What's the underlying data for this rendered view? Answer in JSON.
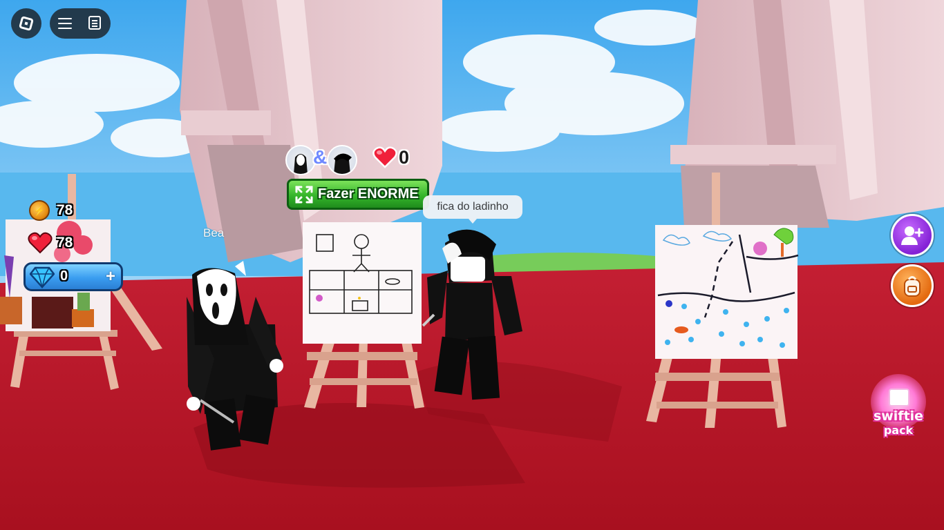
{
  "hud": {
    "roblox_menu_icon": "roblox-logo-icon",
    "menu_icon": "hamburger-menu-icon",
    "chat_icon": "chat-icon",
    "coins": "78",
    "hearts": "78",
    "gems": "0",
    "gems_add_label": "+"
  },
  "canvas_overlay": {
    "painters_joiner": "&",
    "likes": "0",
    "enorme_button_label": "Fazer ENORME"
  },
  "chat": {
    "bubble_text": "fica do ladinho"
  },
  "players": {
    "nearby_name": "Bea"
  },
  "side_buttons": {
    "invite_icon": "add-friend-icon",
    "backpack_icon": "backpack-icon",
    "swiftie_line1": "swiftie",
    "swiftie_line2": "pack"
  },
  "colors": {
    "floor": "#b4162a",
    "sky": "#59b6f2",
    "pillar": "#e6c6cc",
    "accent_green": "#35b52b"
  }
}
